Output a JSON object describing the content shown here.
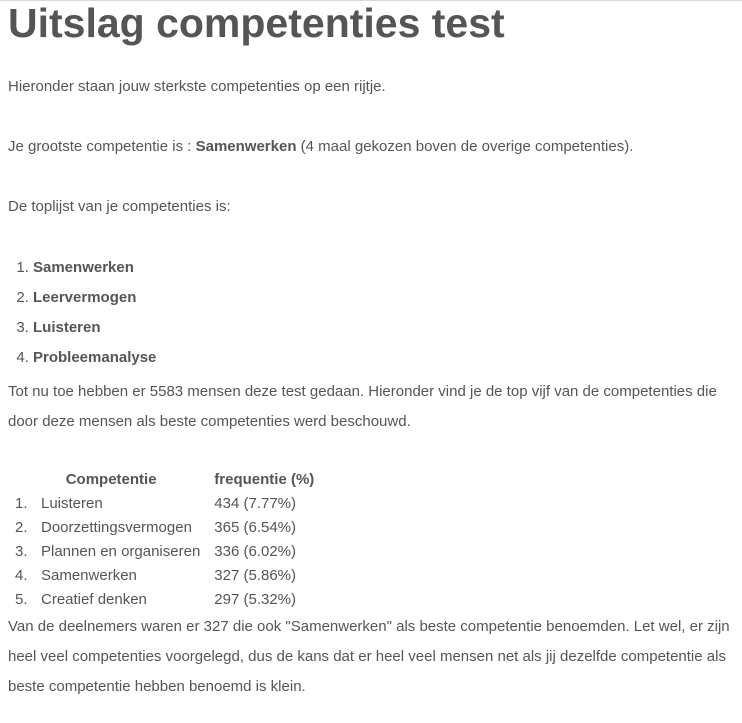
{
  "title": "Uitslag competenties test",
  "intro": "Hieronder staan jouw sterkste competenties op een rijtje.",
  "top_competence": {
    "prefix": "Je grootste competentie is : ",
    "name": "Samenwerken",
    "suffix": " (4 maal gekozen boven de overige competenties)."
  },
  "toplist_intro": "De toplijst van je competenties is:",
  "toplist": [
    "Samenwerken",
    "Leervermogen",
    "Luisteren",
    "Probleemanalyse"
  ],
  "stats_text": "Tot nu toe hebben er 5583 mensen deze test gedaan. Hieronder vind je de top vijf van de competenties die door deze mensen als beste competenties werd beschouwd.",
  "table": {
    "headers": [
      "Competentie",
      "frequentie (%)"
    ],
    "rows": [
      {
        "index": "1.",
        "name": "Luisteren",
        "freq": "434 (7.77%)"
      },
      {
        "index": "2.",
        "name": "Doorzettingsvermogen",
        "freq": "365 (6.54%)"
      },
      {
        "index": "3.",
        "name": "Plannen en organiseren",
        "freq": "336 (6.02%)"
      },
      {
        "index": "4.",
        "name": "Samenwerken",
        "freq": "327 (5.86%)"
      },
      {
        "index": "5.",
        "name": "Creatief denken",
        "freq": "297 (5.32%)"
      }
    ]
  },
  "closing_text": "Van de deelnemers waren er 327 die ook \"Samenwerken\" als beste competentie benoemden. Let wel, er zijn heel veel competenties voorgelegd, dus de kans dat er heel veel mensen net als jij dezelfde competentie als beste competentie hebben benoemd is klein."
}
